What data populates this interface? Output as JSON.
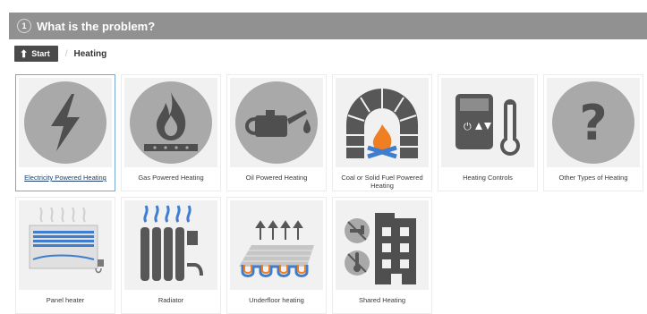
{
  "step": {
    "number": "1",
    "title": "What is the problem?"
  },
  "breadcrumb": {
    "start_label": "Start",
    "separator": "/",
    "current": "Heating"
  },
  "options": [
    {
      "label": "Electricity Powered Heating",
      "icon": "lightning-bolt-icon",
      "selected": true
    },
    {
      "label": "Gas Powered Heating",
      "icon": "gas-flame-icon"
    },
    {
      "label": "Oil Powered Heating",
      "icon": "oil-can-icon"
    },
    {
      "label": "Coal or Solid Fuel Powered Heating",
      "icon": "fireplace-icon"
    },
    {
      "label": "Heating Controls",
      "icon": "thermostat-icon"
    },
    {
      "label": "Other Types of Heating",
      "icon": "question-mark-icon"
    },
    {
      "label": "Panel heater",
      "icon": "panel-heater-icon"
    },
    {
      "label": "Radiator",
      "icon": "radiator-icon"
    },
    {
      "label": "Underfloor heating",
      "icon": "underfloor-heating-icon"
    },
    {
      "label": "Shared Heating",
      "icon": "shared-building-icon"
    }
  ],
  "colors": {
    "step_bar": "#919191",
    "selected_border": "#79a7d8",
    "icon_gray": "#a9a9a9",
    "dark_gray": "#4f4f4f",
    "flame_orange": "#f07e22",
    "accent_blue": "#3f7ecf"
  }
}
